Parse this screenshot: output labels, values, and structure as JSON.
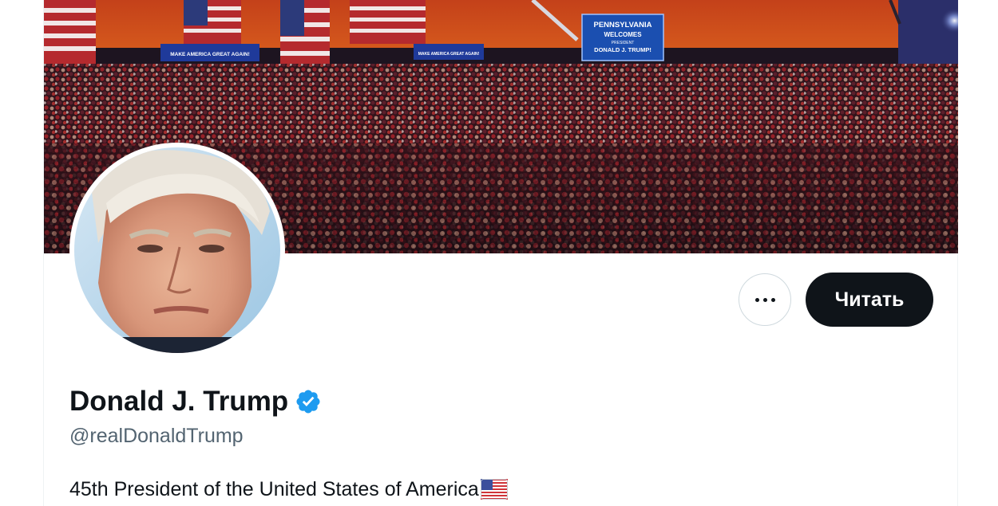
{
  "profile": {
    "display_name": "Donald J. Trump",
    "handle": "@realDonaldTrump",
    "bio": "45th President of the United States of America",
    "verified": true,
    "bio_emoji": "us-flag-icon"
  },
  "actions": {
    "more_icon": "more-horizontal-icon",
    "follow_label": "Читать"
  },
  "banner": {
    "signs": [
      "MAKE AMERICA GREAT AGAIN!",
      "MAKE AMERICA GREAT AGAIN!"
    ],
    "screen_lines": [
      "PENNSYLVANIA",
      "WELCOMES",
      "PRESIDENT",
      "DONALD J. TRUMP!"
    ]
  },
  "colors": {
    "text_primary": "#0f1419",
    "text_secondary": "#536471",
    "follow_button_bg": "#0f1419",
    "verified_blue": "#1d9bf0",
    "border": "#cfd9de"
  }
}
